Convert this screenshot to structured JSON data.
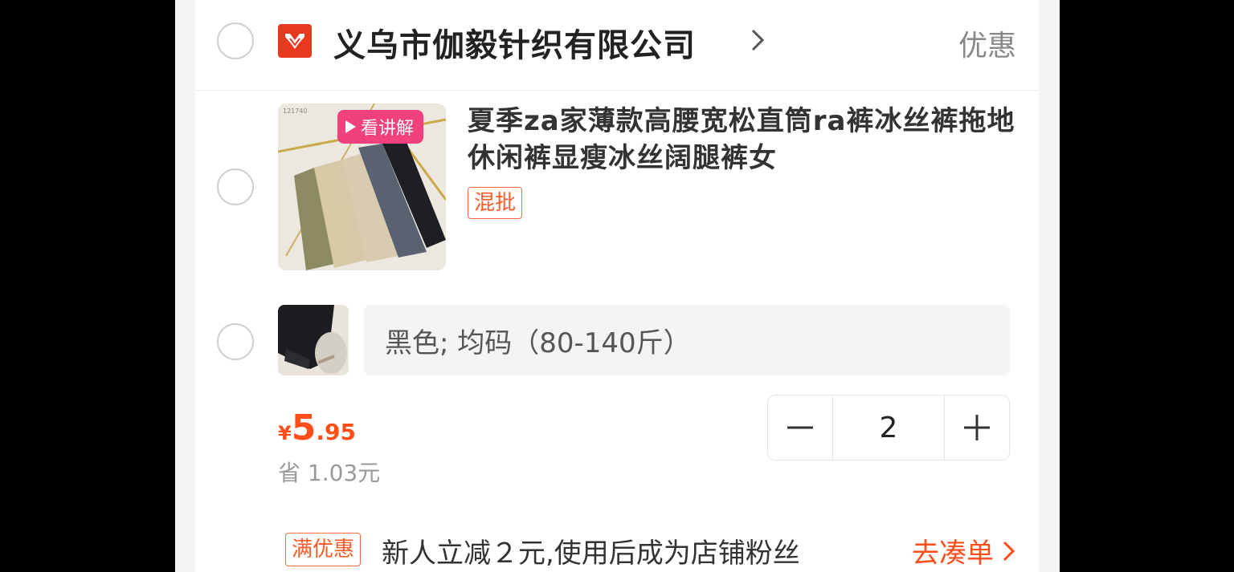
{
  "shop": {
    "name": "义乌市伽毅针织有限公司",
    "discount_label": "优惠",
    "logo_icon": "shop-logo-icon",
    "brand_color": "#e8391e"
  },
  "product": {
    "title": "夏季za家薄款高腰宽松直筒ra裤冰丝裤拖地休闲裤显瘦冰丝阔腿裤女",
    "video_badge": "看讲解",
    "mix_tag": "混批"
  },
  "sku": {
    "spec": "黑色; 均码（80-140斤）"
  },
  "price": {
    "currency": "¥",
    "integer": "5",
    "decimal": ".95",
    "save_text": "省 1.03元",
    "color": "#ff4e1a"
  },
  "quantity": {
    "minus": "−",
    "value": "2",
    "plus": "+"
  },
  "promotion": {
    "tag": "满优惠",
    "text": "新人立减２元,使用后成为店铺粉丝",
    "link": "去凑单"
  }
}
